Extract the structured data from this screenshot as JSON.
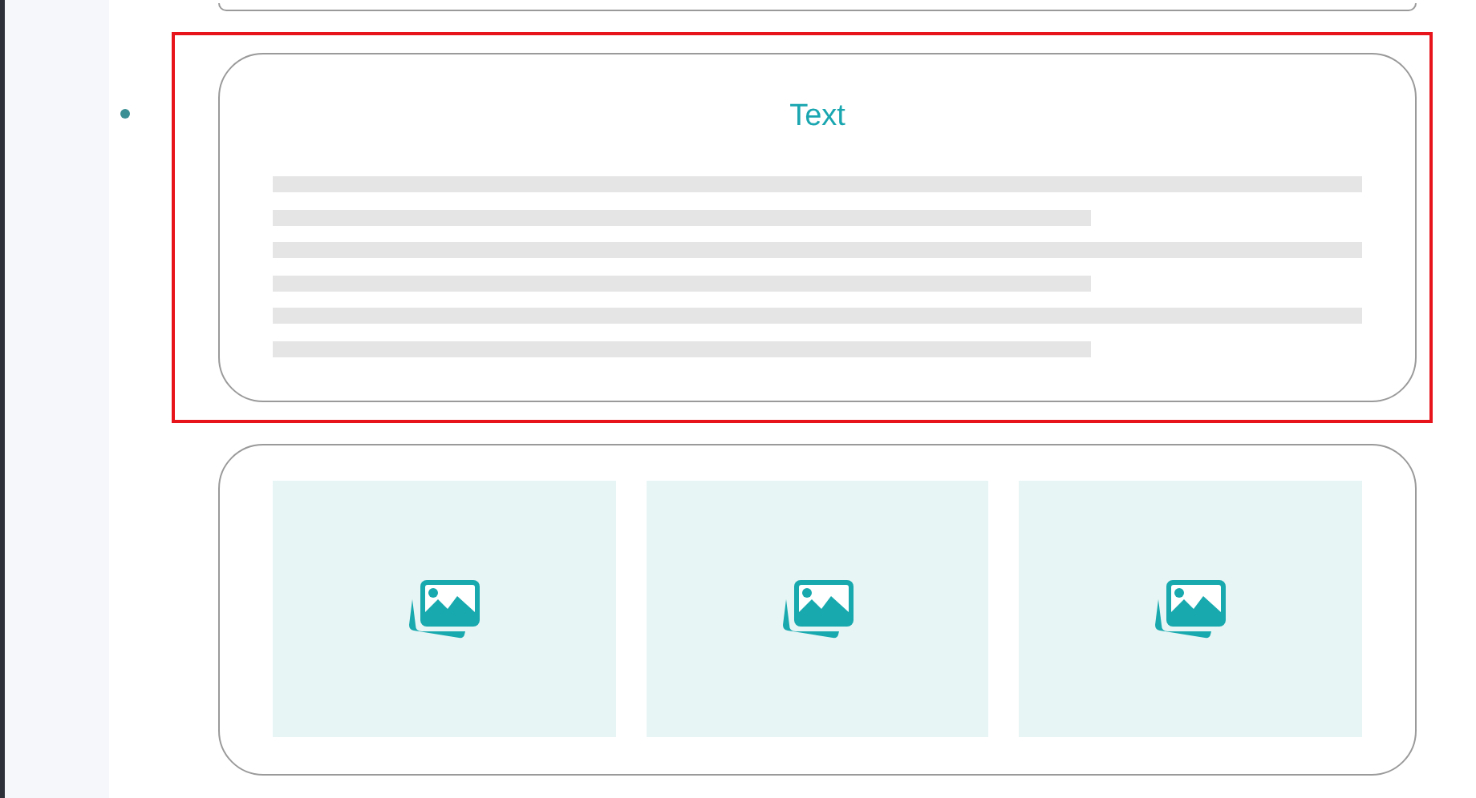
{
  "blocks": [
    {
      "kind": "card",
      "selected": false
    },
    {
      "kind": "text",
      "selected": true,
      "title": "Text"
    },
    {
      "kind": "gallery",
      "selected": false,
      "tiles": [
        {
          "kind": "image-placeholder"
        },
        {
          "kind": "image-placeholder"
        },
        {
          "kind": "image-placeholder"
        }
      ]
    }
  ]
}
